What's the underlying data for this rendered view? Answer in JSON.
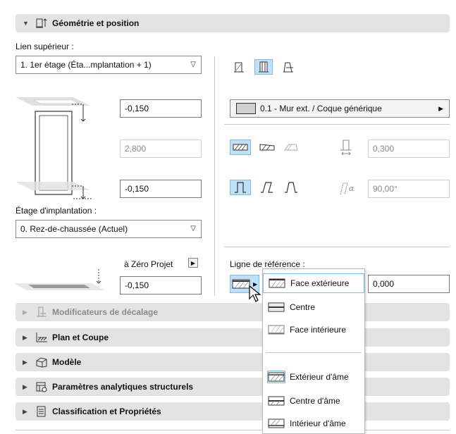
{
  "header": {
    "title": "Géométrie et position"
  },
  "top_link": {
    "label": "Lien supérieur :",
    "value": "1. 1er étage (Éta...mplantation + 1)"
  },
  "values": {
    "top_offset": "-0,150",
    "height": "2,800",
    "bottom_offset": "-0,150",
    "thickness": "0,300",
    "angle": "90,00°",
    "ref_offset": "0,000",
    "zero_project": "-0,150"
  },
  "home_story": {
    "label": "Étage d'implantation :",
    "value": "0. Rez-de-chaussée (Actuel)"
  },
  "zero_project_label": "à Zéro Projet",
  "composite": {
    "label": "0.1 - Mur ext. / Coque générique"
  },
  "ref_line": {
    "label": "Ligne de référence :"
  },
  "ref_menu": [
    "Face extérieure",
    "Centre",
    "Face intérieure",
    "Extérieur d'âme",
    "Centre d'âme",
    "Intérieur d'âme"
  ],
  "sections": [
    {
      "title": "Modificateurs de décalage",
      "icon": "offset-modifier-icon",
      "disabled": true
    },
    {
      "title": "Plan et Coupe",
      "icon": "plan-section-icon",
      "disabled": false
    },
    {
      "title": "Modèle",
      "icon": "model-icon",
      "disabled": false
    },
    {
      "title": "Paramètres analytiques structurels",
      "icon": "structural-analysis-icon",
      "disabled": false
    },
    {
      "title": "Classification et Propriétés",
      "icon": "classification-icon",
      "disabled": false
    }
  ],
  "colors": {
    "selection": "#bfe0f7",
    "selection_border": "#7fbbe6",
    "section_bg": "#e3e3e3"
  }
}
